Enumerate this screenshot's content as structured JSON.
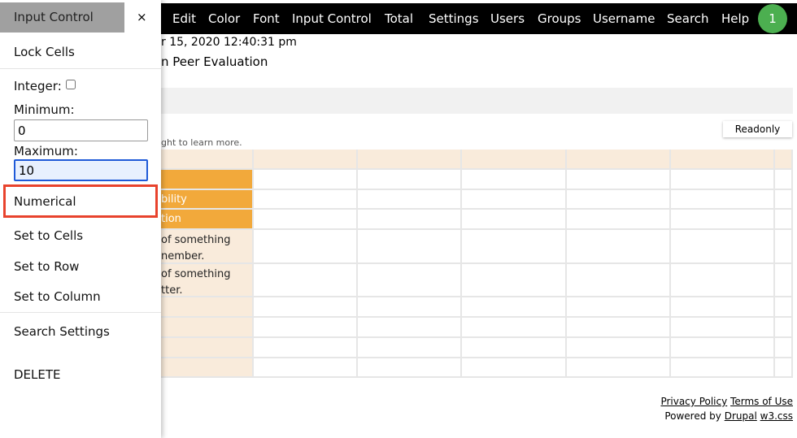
{
  "nav": {
    "items": [
      "Edit",
      "Color",
      "Font",
      "Input Control",
      "Total",
      "Settings",
      "Users",
      "Groups",
      "Username",
      "Search",
      "Help"
    ],
    "badge": "1"
  },
  "page": {
    "date_fragment": "r 15, 2020 12:40:31 pm",
    "title_fragment": "n Peer Evaluation",
    "hint_fragment": "ght to learn more.",
    "readonly_label": "Readonly"
  },
  "table": {
    "rows": [
      "",
      "bility",
      "tion",
      "of something\nnember.",
      "of something\ntter.",
      "",
      "",
      "",
      ""
    ]
  },
  "footer": {
    "privacy": "Privacy Policy",
    "terms": "Terms of Use",
    "powered": "Powered by",
    "drupal": "Drupal",
    "w3": "w3.css"
  },
  "sidebar": {
    "title": "Input Control",
    "close": "×",
    "lock_cells": "Lock Cells",
    "integer_label": "Integer:",
    "minimum_label": "Minimum:",
    "minimum_value": "0",
    "maximum_label": "Maximum:",
    "maximum_value": "10",
    "numerical": "Numerical",
    "set_cells": "Set to Cells",
    "set_row": "Set to Row",
    "set_column": "Set to Column",
    "search_settings": "Search Settings",
    "delete": "DELETE"
  },
  "colors": {
    "nav_bg": "#000000",
    "badge": "#4caf50",
    "row_header": "#f9ebdb",
    "highlight_row": "#f2a93b",
    "highlight_box": "#e8432d"
  }
}
